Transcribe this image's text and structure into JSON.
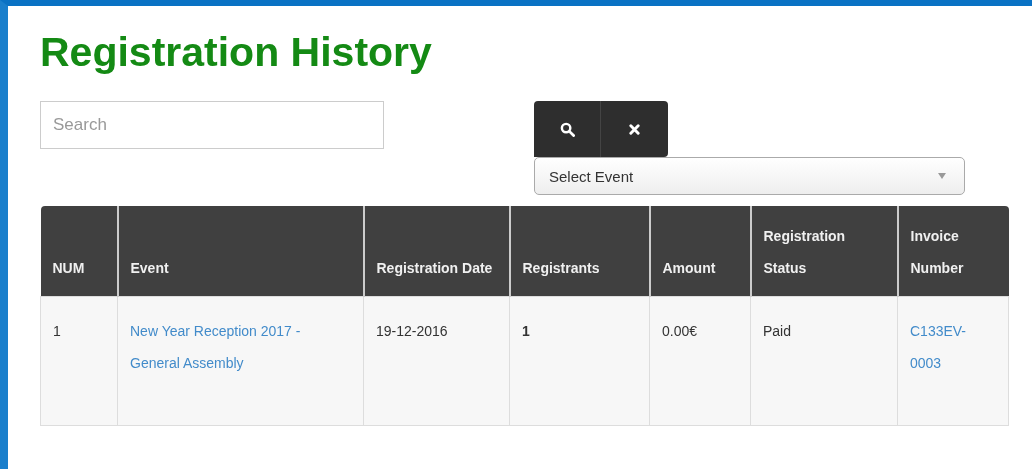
{
  "title": "Registration History",
  "search": {
    "placeholder": "Search"
  },
  "buttons": [
    {
      "kind": "search"
    },
    {
      "kind": "clear"
    }
  ],
  "event_select": {
    "value": "Select Event"
  },
  "table": {
    "columns": [
      "NUM",
      "Event",
      "Registration Date",
      "Registrants",
      "Amount",
      "Registration Status",
      "Invoice Number"
    ],
    "rows": [
      [
        {
          "kind": "text",
          "text": "1"
        },
        {
          "kind": "link",
          "text": "New Year Reception 2017 - General Assembly"
        },
        {
          "kind": "text",
          "text": "19-12-2016"
        },
        {
          "kind": "bold",
          "text": "1"
        },
        {
          "kind": "text",
          "text": "0.00€"
        },
        {
          "kind": "text",
          "text": "Paid"
        },
        {
          "kind": "link",
          "text": "C133EV-0003"
        }
      ]
    ]
  }
}
